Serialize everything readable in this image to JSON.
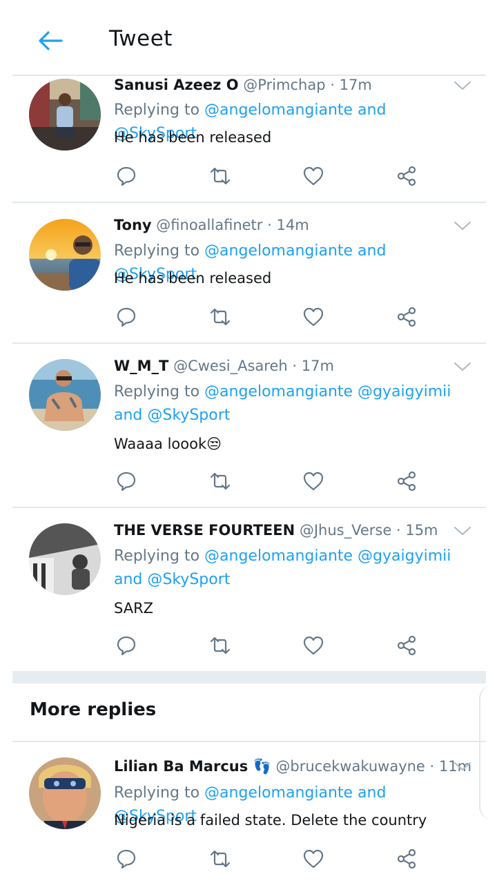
{
  "header": {
    "title": "Tweet"
  },
  "tweets": [
    {
      "name": "Sanusi Azeez O",
      "handle": "@Primchap",
      "dot": "·",
      "time": "17m",
      "replying_prefix": "Replying to",
      "mention1": "@angelomangiante",
      "mention2": "",
      "and": "and",
      "mention_last": "@SkySport",
      "text": "He has been released"
    },
    {
      "name": "Tony",
      "handle": "@finoallafinetr",
      "dot": "·",
      "time": "14m",
      "replying_prefix": "Replying to",
      "mention1": "@angelomangiante",
      "mention2": "",
      "and": "and",
      "mention_last": "@SkySport",
      "text": "He has been released"
    },
    {
      "name": "W_M_T",
      "handle": "@Cwesi_Asareh",
      "dot": "·",
      "time": "17m",
      "replying_prefix": "Replying to",
      "mention1": "@angelomangiante",
      "mention2": "@gyaigyimii",
      "and": "and",
      "mention_last": "@SkySport",
      "text": "Waaaa loook😒"
    },
    {
      "name": "THE VERSE FOURTEEN",
      "handle": "@Jhus_Verse",
      "dot": "·",
      "time": "15m",
      "replying_prefix": "Replying to",
      "mention1": "@angelomangiante",
      "mention2": "@gyaigyimii",
      "and": "and",
      "mention_last": "@SkySport",
      "text": "SARZ"
    }
  ],
  "more_replies": {
    "title": "More replies",
    "tweet": {
      "name": "Lilian Ba Marcus 👣",
      "handle": "@brucekwakuwayne",
      "dot": "·",
      "time": "11m",
      "replying_prefix": "Replying to",
      "mention1": "@angelomangiante",
      "and": "and",
      "mention_last": "@SkySport",
      "text": "Nigeria is a failed state. Delete the country"
    }
  },
  "colors": {
    "accent": "#1da1f2",
    "secondary": "#657786",
    "divider": "#e1e8ed"
  },
  "icons": [
    "back-arrow-icon",
    "reply-icon",
    "retweet-icon",
    "like-icon",
    "share-icon",
    "chevron-down-icon"
  ]
}
